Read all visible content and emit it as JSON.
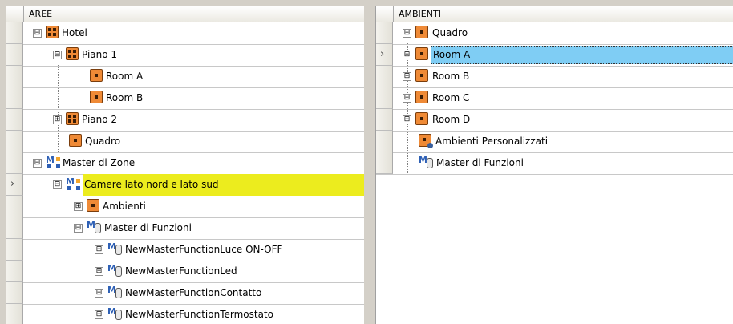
{
  "left_panel": {
    "header": "AREE",
    "rows": [
      {
        "label": "Hotel",
        "icon": "area-icon",
        "expander": "⊟",
        "selected": false
      },
      {
        "label": "Piano 1",
        "icon": "area-icon",
        "expander": "⊟",
        "selected": false
      },
      {
        "label": "Room A",
        "icon": "room-icon",
        "expander": "",
        "selected": false
      },
      {
        "label": "Room B",
        "icon": "room-icon",
        "expander": "",
        "selected": false
      },
      {
        "label": "Piano 2",
        "icon": "area-icon",
        "expander": "⊞",
        "selected": false
      },
      {
        "label": "Quadro",
        "icon": "room-icon",
        "expander": "",
        "selected": false
      },
      {
        "label": "Master di Zone",
        "icon": "master-zone-icon",
        "expander": "⊟",
        "selected": false
      },
      {
        "label": "Camere lato nord e lato sud",
        "icon": "master-zone-icon",
        "expander": "⊟",
        "selected": true
      },
      {
        "label": "Ambienti",
        "icon": "room-icon",
        "expander": "⊞",
        "selected": false
      },
      {
        "label": "Master di Funzioni",
        "icon": "master-function-icon",
        "expander": "⊟",
        "selected": false
      },
      {
        "label": "NewMasterFunctionLuce ON-OFF",
        "icon": "master-function-icon",
        "expander": "⊞",
        "selected": false
      },
      {
        "label": "NewMasterFunctionLed",
        "icon": "master-function-icon",
        "expander": "⊞",
        "selected": false
      },
      {
        "label": "NewMasterFunctionContatto",
        "icon": "master-function-icon",
        "expander": "⊞",
        "selected": false
      },
      {
        "label": "NewMasterFunctionTermostato",
        "icon": "master-function-icon",
        "expander": "⊞",
        "selected": false
      }
    ],
    "current_row_indicator": "›"
  },
  "right_panel": {
    "header": "AMBIENTI",
    "rows": [
      {
        "label": "Quadro",
        "icon": "room-icon",
        "expander": "⊞",
        "selected": false
      },
      {
        "label": "Room A",
        "icon": "room-icon",
        "expander": "⊞",
        "selected": true
      },
      {
        "label": "Room B",
        "icon": "room-icon",
        "expander": "⊞",
        "selected": false
      },
      {
        "label": "Room C",
        "icon": "room-icon",
        "expander": "⊞",
        "selected": false
      },
      {
        "label": "Room D",
        "icon": "room-icon",
        "expander": "⊞",
        "selected": false
      },
      {
        "label": "Ambienti Personalizzati",
        "icon": "custom-rooms-icon",
        "expander": "",
        "selected": false
      },
      {
        "label": "Master di Funzioni",
        "icon": "master-function-icon",
        "expander": "",
        "selected": false
      }
    ],
    "current_row_indicator": "›"
  },
  "colors": {
    "selected_yellow": "#ecec1e",
    "selected_blue": "#7fcdf4",
    "icon_orange": "#ef8a36"
  }
}
